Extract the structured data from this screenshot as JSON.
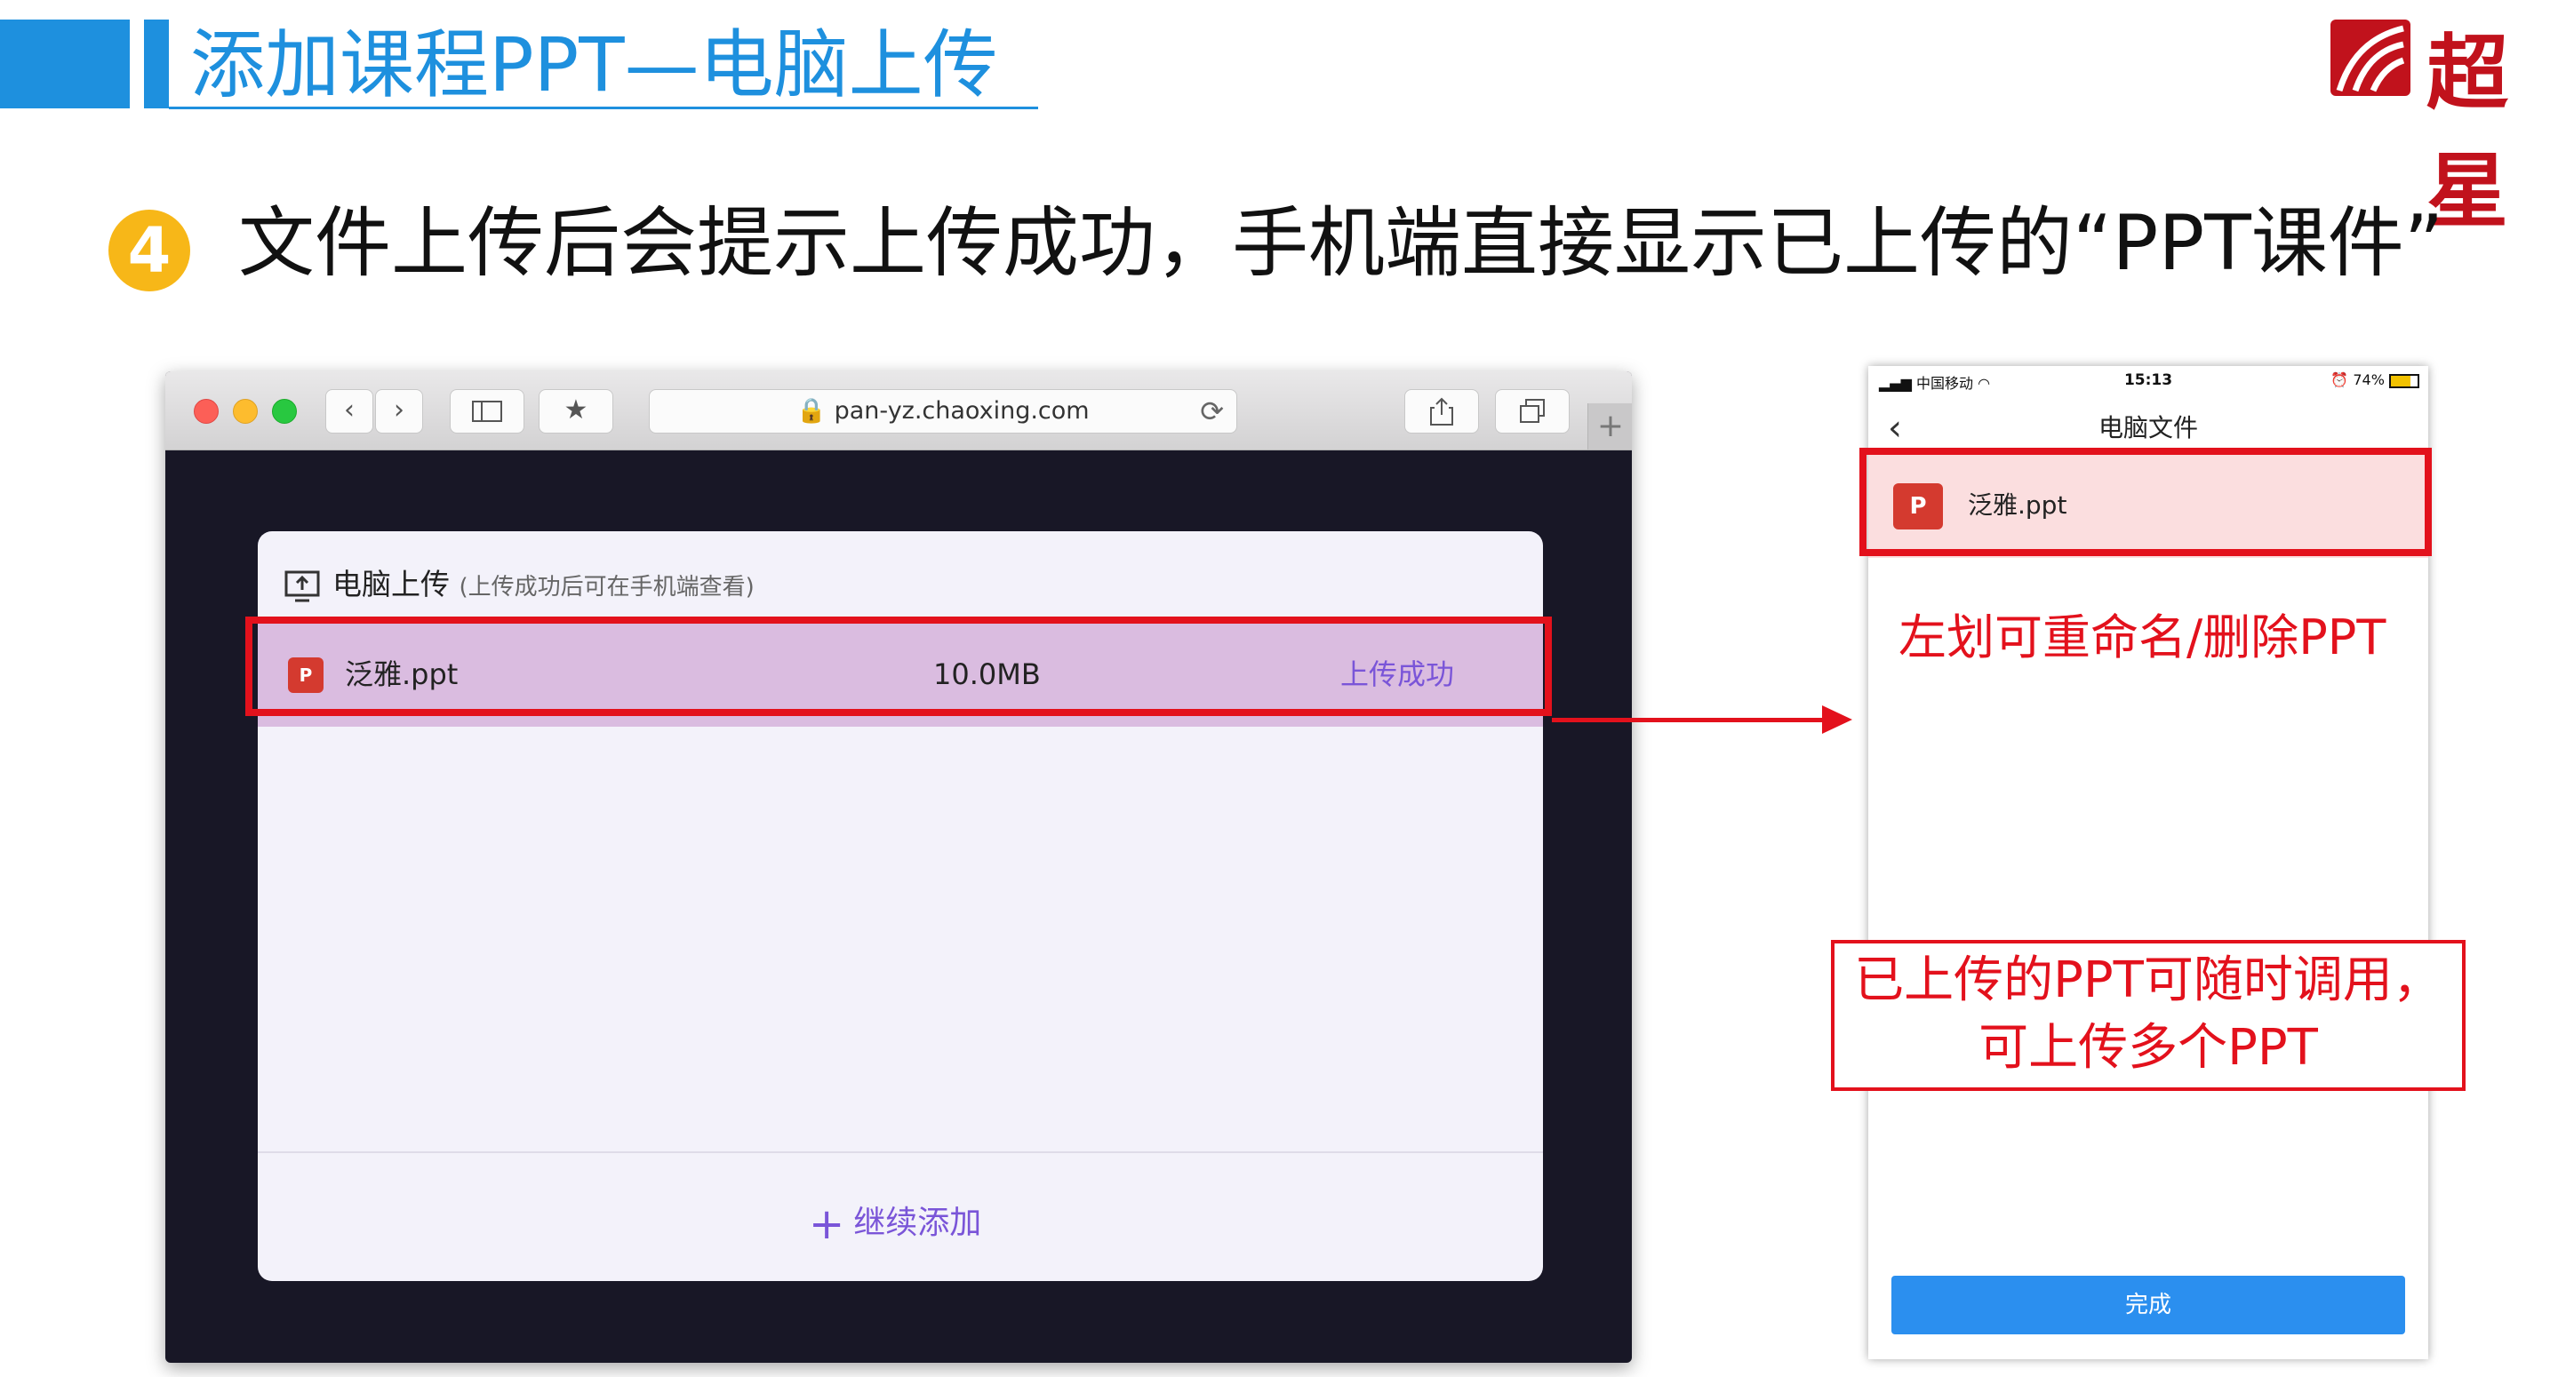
{
  "slide": {
    "title": "添加课程PPT—电脑上传",
    "logo_text": "超星",
    "step_number": "4",
    "step_text": "文件上传后会提示上传成功，手机端直接显示已上传的“PPT课件”"
  },
  "browser": {
    "url": "pan-yz.chaoxing.com",
    "panel": {
      "title": "电脑上传",
      "subtitle": "(上传成功后可在手机端查看)",
      "file": {
        "icon": "P",
        "name": "泛雅.ppt",
        "size": "10.0MB",
        "status": "上传成功"
      },
      "add_more": "继续添加"
    }
  },
  "phone": {
    "status_bar": {
      "carrier": "中国移动",
      "time": "15:13",
      "battery": "74%"
    },
    "nav_title": "电脑文件",
    "file": {
      "icon": "P",
      "name": "泛雅.ppt"
    },
    "done_label": "完成"
  },
  "annotations": {
    "note1": "左划可重命名/删除PPT",
    "note2_line1": "已上传的PPT可随时调用，",
    "note2_line2": "可上传多个PPT"
  },
  "colors": {
    "accent_blue": "#1e90de",
    "highlight_red": "#e3111c",
    "purple": "#7a55d8"
  }
}
